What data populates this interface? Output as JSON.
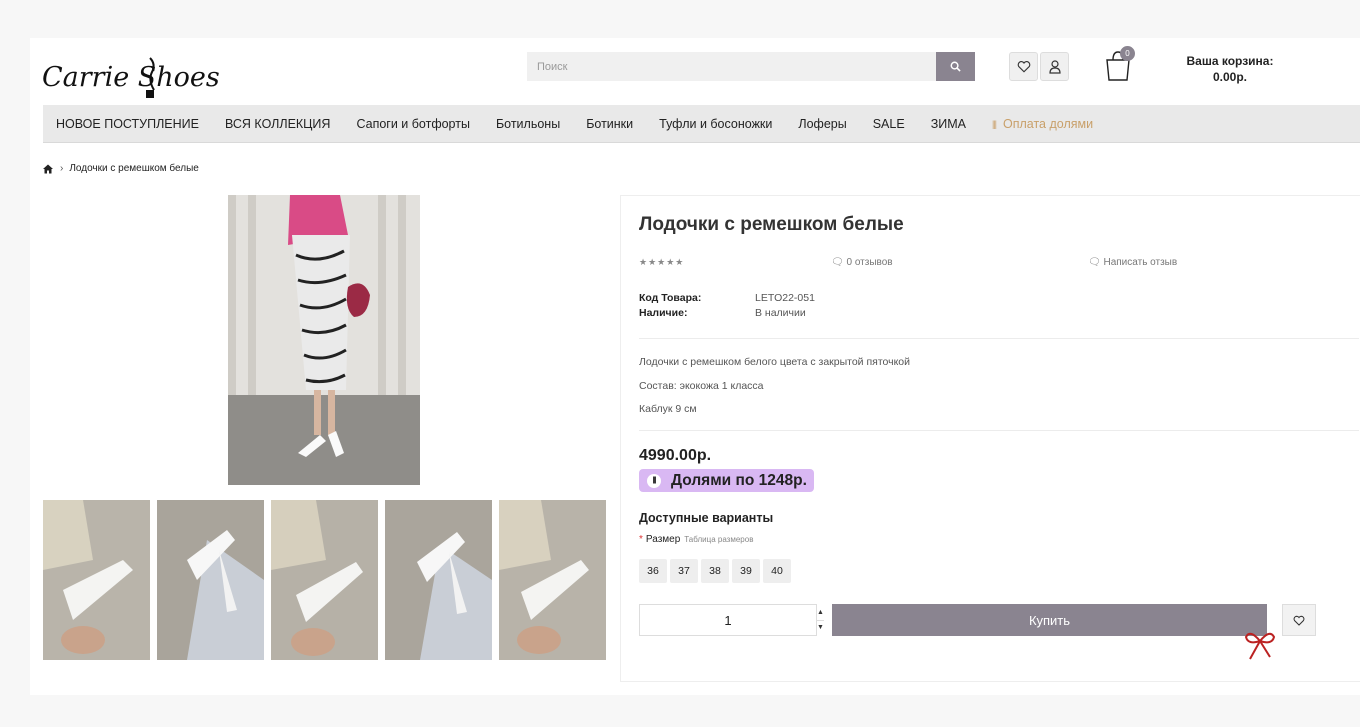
{
  "header": {
    "logo_text": "Carrie Shoes",
    "search_placeholder": "Поиск",
    "cart_count": "0",
    "cart_label": "Ваша корзина:",
    "cart_total": "0.00р."
  },
  "nav": {
    "items": [
      "НОВОЕ ПОСТУПЛЕНИЕ",
      "ВСЯ КОЛЛЕКЦИЯ",
      "Сапоги и ботфорты",
      "Ботильоны",
      "Ботинки",
      "Туфли и босоножки",
      "Лоферы",
      "SALE",
      "ЗИМА"
    ],
    "payment_label": "Оплата долями"
  },
  "breadcrumb": {
    "current": "Лодочки с ремешком белые"
  },
  "product": {
    "title": "Лодочки с ремешком белые",
    "stars": "★★★★★",
    "reviews": "0 отзывов",
    "write_review": "Написать отзыв",
    "code_label": "Код Товара:",
    "code_value": "LETO22-051",
    "availability_label": "Наличие:",
    "availability_value": "В наличии",
    "description": [
      "Лодочки с ремешком белого цвета с закрытой пяточкой",
      "Состав: экокожа 1 класса",
      "Каблук 9 см"
    ],
    "price": "4990.00р.",
    "dolyami": "Долями по 1248р.",
    "variants_title": "Доступные варианты",
    "size_label": "Размер",
    "size_table": "Таблица размеров",
    "sizes": [
      "36",
      "37",
      "38",
      "39",
      "40"
    ],
    "quantity": "1",
    "buy_label": "Купить"
  },
  "colors": {
    "accent": "#8a8490",
    "nav_bg": "#e9e9e9",
    "dolyami_bg": "#d9b8f3",
    "payment_text": "#c9a06a"
  }
}
